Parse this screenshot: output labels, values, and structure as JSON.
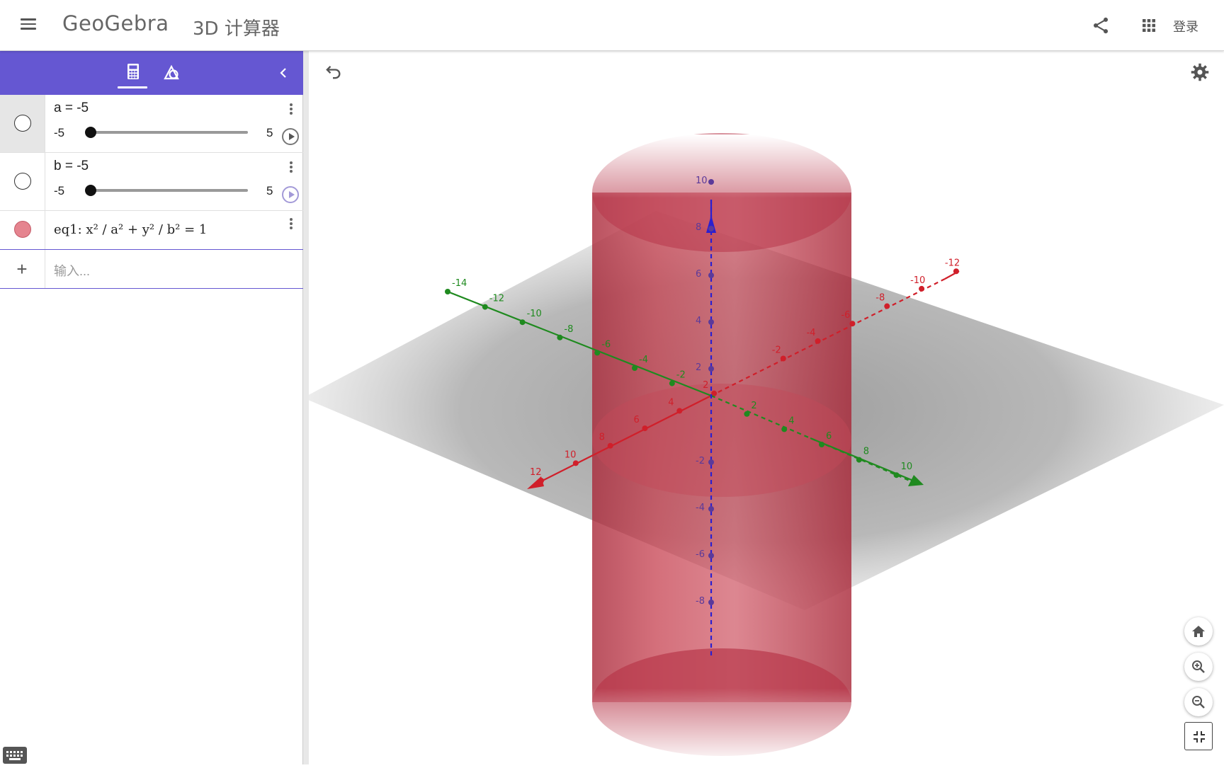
{
  "header": {
    "app_title": "GeoGebra",
    "app_subtitle": "3D 计算器",
    "login_label": "登录"
  },
  "algebra": {
    "sliders": [
      {
        "definition": "a = -5",
        "min": "-5",
        "max": "5",
        "value": -5
      },
      {
        "definition": "b = -5",
        "min": "-5",
        "max": "5",
        "value": -5
      }
    ],
    "equation": {
      "definition": "eq1: x² / a² + y² / b² = 1",
      "color": "#e5848f"
    },
    "input_placeholder": "输入..."
  },
  "graphics": {
    "plane_color": "#9a9a9a",
    "surface_color": "#c6404f",
    "axis_colors": {
      "x": "#d01f2a",
      "y": "#1f8a1f",
      "z": "#2a1fd0"
    },
    "x_axis_ticks": [
      "12",
      "10",
      "8",
      "6",
      "4",
      "2",
      "-2",
      "-4",
      "-6",
      "-8",
      "-10",
      "-12"
    ],
    "y_axis_ticks": [
      "-14",
      "-12",
      "-10",
      "-8",
      "-6",
      "-4",
      "-2",
      "2",
      "4",
      "6",
      "8",
      "10"
    ],
    "z_axis_ticks": [
      "10",
      "8",
      "6",
      "4",
      "2",
      "-2",
      "-4",
      "-6",
      "-8"
    ]
  },
  "icons": {
    "menu": "menu-icon",
    "share": "share-icon",
    "apps": "apps-icon",
    "algebra_tab": "calculator-icon",
    "tools_tab": "tools-icon",
    "collapse": "chevron-left-icon",
    "undo": "undo-icon",
    "settings": "gear-icon",
    "home": "home-icon",
    "zoom_in": "zoom-in-icon",
    "zoom_out": "zoom-out-icon",
    "fullscreen": "exit-fullscreen-icon",
    "keyboard": "keyboard-icon",
    "play": "play-icon",
    "add": "plus-icon"
  }
}
